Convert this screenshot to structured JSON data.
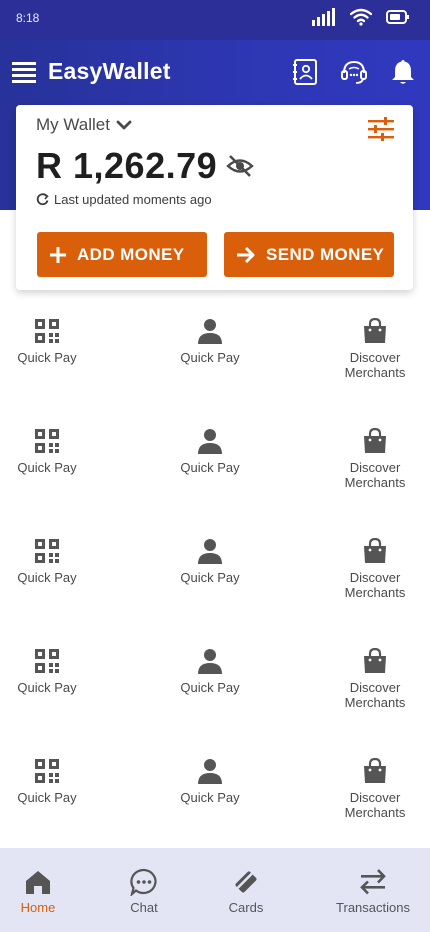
{
  "status_bar": {
    "time": "8:18"
  },
  "header": {
    "title": "EasyWallet",
    "icons": [
      "menu-icon",
      "contacts-book-icon",
      "support-headset-icon",
      "bell-icon"
    ]
  },
  "wallet": {
    "label": "My Wallet",
    "balance": "R 1,262.79",
    "updated": "Last updated moments ago",
    "add_money": "ADD MONEY",
    "send_money": "SEND MONEY"
  },
  "grid": {
    "rows": [
      {
        "left": "Quick Pay",
        "middle": "Quick Pay",
        "right": "Discover Merchants"
      },
      {
        "left": "Quick Pay",
        "middle": "Quick Pay",
        "right": "Discover Merchants"
      },
      {
        "left": "Quick Pay",
        "middle": "Quick Pay",
        "right": "Discover Merchants"
      },
      {
        "left": "Quick Pay",
        "middle": "Quick Pay",
        "right": "Discover Merchants"
      },
      {
        "left": "Quick Pay",
        "middle": "Quick Pay",
        "right": "Discover Merchants"
      }
    ],
    "icons": {
      "left": "qr-code-icon",
      "middle": "person-icon",
      "right": "shopping-bag-icon"
    }
  },
  "nav": {
    "home": "Home",
    "chat": "Chat",
    "cards": "Cards",
    "transactions": "Transactions",
    "active": "home"
  },
  "colors": {
    "header_blue": "#2e37b4",
    "accent_orange": "#d95f0a",
    "nav_bg": "#e3e5f4"
  }
}
